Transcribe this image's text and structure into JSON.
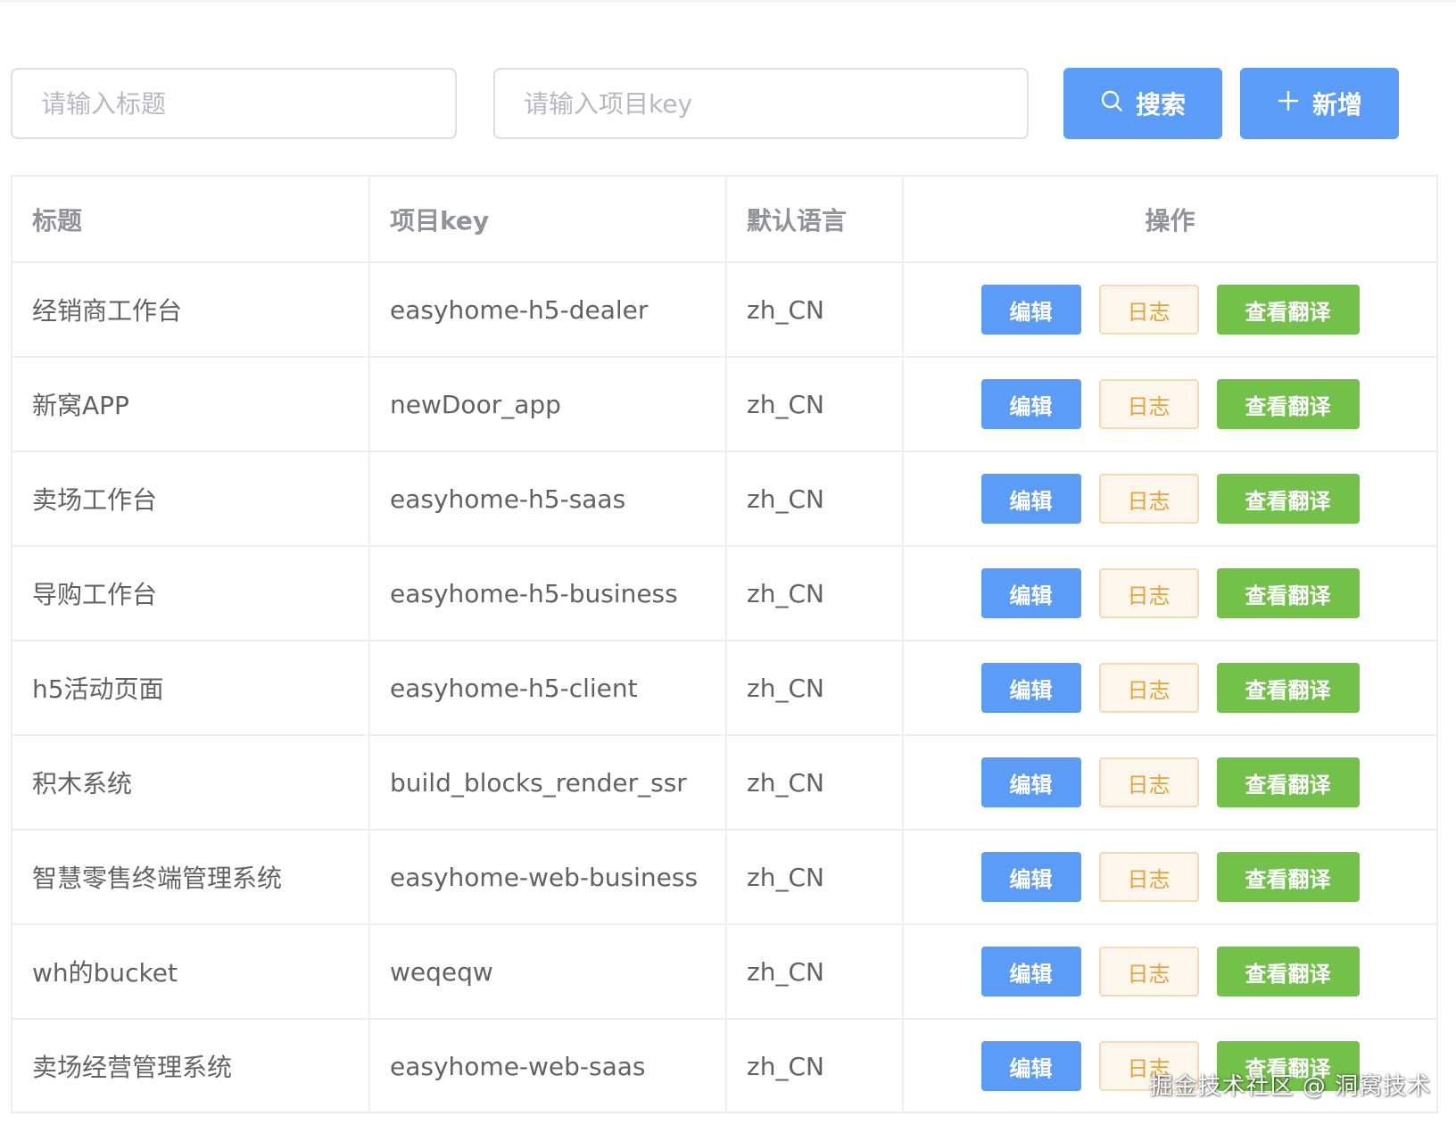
{
  "search": {
    "title_placeholder": "请输入标题",
    "key_placeholder": "请输入项目key",
    "search_label": "搜索",
    "add_label": "新增"
  },
  "table": {
    "headers": {
      "title": "标题",
      "key": "项目key",
      "lang": "默认语言",
      "ops": "操作"
    },
    "rows": [
      {
        "title": "经销商工作台",
        "key": "easyhome-h5-dealer",
        "lang": "zh_CN"
      },
      {
        "title": "新窝APP",
        "key": "newDoor_app",
        "lang": "zh_CN"
      },
      {
        "title": "卖场工作台",
        "key": "easyhome-h5-saas",
        "lang": "zh_CN"
      },
      {
        "title": "导购工作台",
        "key": "easyhome-h5-business",
        "lang": "zh_CN"
      },
      {
        "title": "h5活动页面",
        "key": "easyhome-h5-client",
        "lang": "zh_CN"
      },
      {
        "title": "积木系统",
        "key": "build_blocks_render_ssr",
        "lang": "zh_CN"
      },
      {
        "title": "智慧零售终端管理系统",
        "key": "easyhome-web-business",
        "lang": "zh_CN"
      },
      {
        "title": "wh的bucket",
        "key": "weqeqw",
        "lang": "zh_CN"
      },
      {
        "title": "卖场经营管理系统",
        "key": "easyhome-web-saas",
        "lang": "zh_CN"
      }
    ],
    "actions": {
      "edit": "编辑",
      "log": "日志",
      "translate": "查看翻译"
    }
  },
  "watermark": "掘金技术社区 @ 洞窝技术",
  "colors": {
    "primary": "#5a9cf8",
    "success": "#73c04a",
    "warning_text": "#e6a23c",
    "warning_bg": "#fdf6ec"
  },
  "icons": {
    "search": "search-icon",
    "add": "plus-icon"
  }
}
